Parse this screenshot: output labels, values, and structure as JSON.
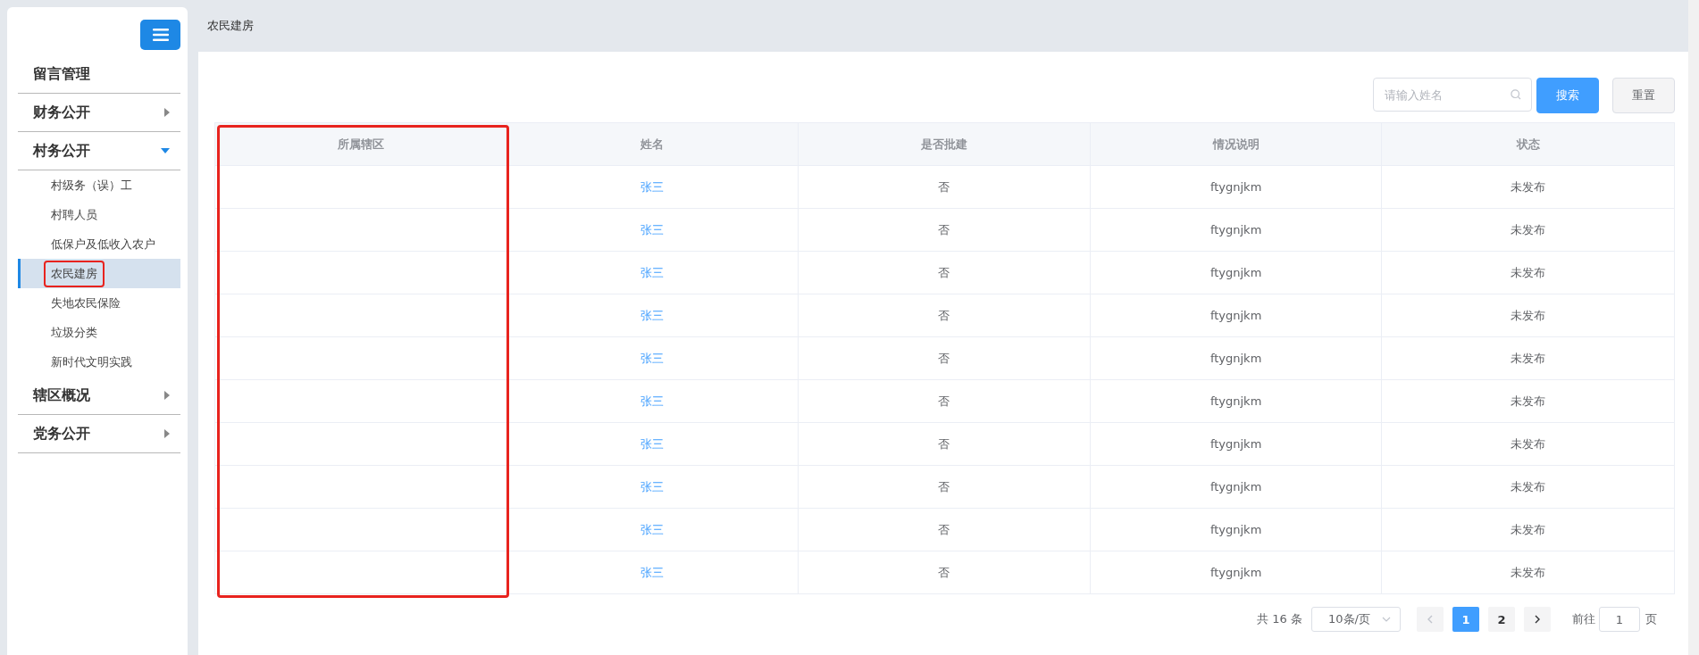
{
  "breadcrumb": "农民建房",
  "sidebar": {
    "items": [
      {
        "label": "留言管理",
        "kind": "link"
      },
      {
        "label": "财务公开",
        "kind": "group",
        "expanded": false
      },
      {
        "label": "村务公开",
        "kind": "group",
        "expanded": true,
        "children": [
          {
            "label": "村级务（误）工",
            "selected": false,
            "highlighted": false
          },
          {
            "label": "村聘人员",
            "selected": false,
            "highlighted": false
          },
          {
            "label": "低保户及低收入农户",
            "selected": false,
            "highlighted": false
          },
          {
            "label": "农民建房",
            "selected": true,
            "highlighted": true
          },
          {
            "label": "失地农民保险",
            "selected": false,
            "highlighted": false
          },
          {
            "label": "垃圾分类",
            "selected": false,
            "highlighted": false
          },
          {
            "label": "新时代文明实践",
            "selected": false,
            "highlighted": false
          }
        ]
      },
      {
        "label": "辖区概况",
        "kind": "group",
        "expanded": false
      },
      {
        "label": "党务公开",
        "kind": "group",
        "expanded": false
      }
    ]
  },
  "search": {
    "placeholder": "请输入姓名"
  },
  "buttons": {
    "search": "搜索",
    "reset": "重置"
  },
  "table": {
    "columns": [
      {
        "label": "所属辖区",
        "highlighted": true
      },
      {
        "label": "姓名",
        "highlighted": false
      },
      {
        "label": "是否批建",
        "highlighted": false
      },
      {
        "label": "情况说明",
        "highlighted": false
      },
      {
        "label": "状态",
        "highlighted": false
      }
    ],
    "rows": [
      [
        "",
        "张三",
        "否",
        "ftygnjkm",
        "未发布"
      ],
      [
        "",
        "张三",
        "否",
        "ftygnjkm",
        "未发布"
      ],
      [
        "",
        "张三",
        "否",
        "ftygnjkm",
        "未发布"
      ],
      [
        "",
        "张三",
        "否",
        "ftygnjkm",
        "未发布"
      ],
      [
        "",
        "张三",
        "否",
        "ftygnjkm",
        "未发布"
      ],
      [
        "",
        "张三",
        "否",
        "ftygnjkm",
        "未发布"
      ],
      [
        "",
        "张三",
        "否",
        "ftygnjkm",
        "未发布"
      ],
      [
        "",
        "张三",
        "否",
        "ftygnjkm",
        "未发布"
      ],
      [
        "",
        "张三",
        "否",
        "ftygnjkm",
        "未发布"
      ],
      [
        "",
        "张三",
        "否",
        "ftygnjkm",
        "未发布"
      ]
    ]
  },
  "pagination": {
    "total": "共 16 条",
    "page_size": "10条/页",
    "pages": [
      {
        "label": "1",
        "selected": true
      },
      {
        "label": "2",
        "selected": false
      }
    ],
    "goto_label": "前往",
    "goto_value": "1",
    "goto_suffix": "页"
  }
}
